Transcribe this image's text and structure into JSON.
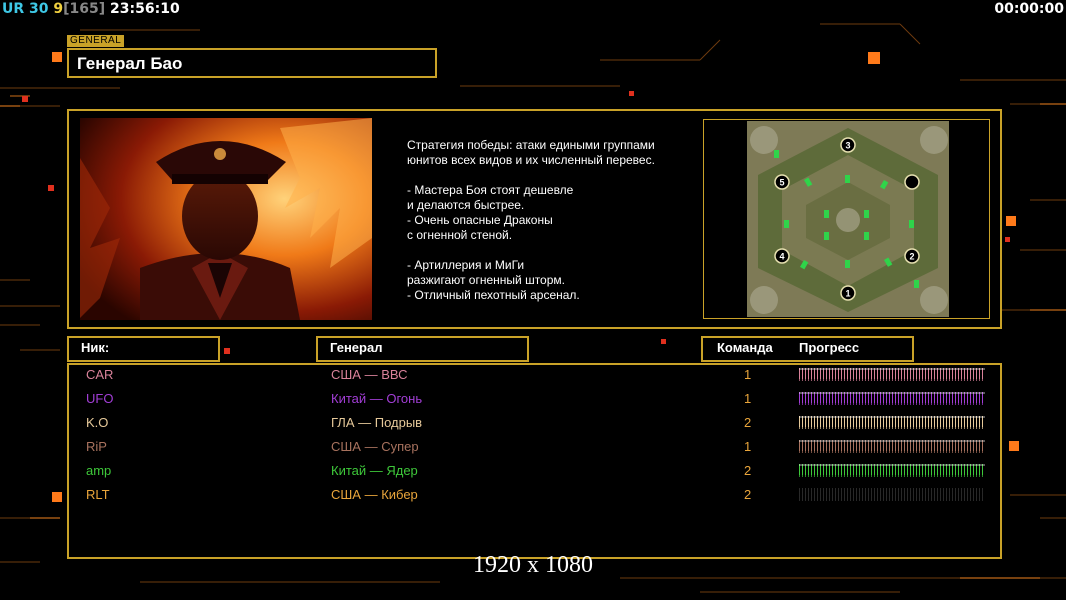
{
  "hud": {
    "version_prefix": "UR",
    "fps": "30",
    "num": "9",
    "bracket": "[165]",
    "clock": "23:56:10",
    "timer": "00:00:00"
  },
  "general_tab": "GENERAL",
  "general_name": "Генерал Бао",
  "strategy_lines": [
    "Стратегия победы: атаки едиными группами",
    "юнитов всех видов и их численный перевес.",
    "",
    "- Мастера Боя стоят дешевле",
    "и делаются быстрее.",
    "- Очень опасные Драконы",
    "с огненной стеной.",
    "",
    "- Артиллерия и МиГи",
    "разжигают огненный шторм.",
    "- Отличный пехотный арсенал."
  ],
  "map": {
    "slots": [
      "1",
      "2",
      "3",
      "4",
      "5",
      "5"
    ]
  },
  "headers": {
    "nick": "Ник:",
    "general": "Генерал",
    "team": "Команда",
    "progress": "Прогресс"
  },
  "players": [
    {
      "nick": "CAR",
      "general": "США — ВВС",
      "team": "1",
      "progress": 1.0,
      "color": "#d9829a"
    },
    {
      "nick": "UFO",
      "general": "Китай — Огонь",
      "team": "1",
      "progress": 1.0,
      "color": "#a23ed6"
    },
    {
      "nick": "K.O",
      "general": "ГЛА — Подрыв",
      "team": "2",
      "progress": 1.0,
      "color": "#e6c99a"
    },
    {
      "nick": "RiP",
      "general": "США — Супер",
      "team": "1",
      "progress": 1.0,
      "color": "#a8725e"
    },
    {
      "nick": "amp",
      "general": "Китай — Ядер",
      "team": "2",
      "progress": 1.0,
      "color": "#3ec83a"
    },
    {
      "nick": "RLT",
      "general": "США — Кибер",
      "team": "2",
      "progress": 0.0,
      "color": "#e9a53b"
    }
  ],
  "resolution_label": "1920 x 1080",
  "colors": {
    "frame": "#c9a228",
    "accent_orange": "#ff7a1a"
  }
}
